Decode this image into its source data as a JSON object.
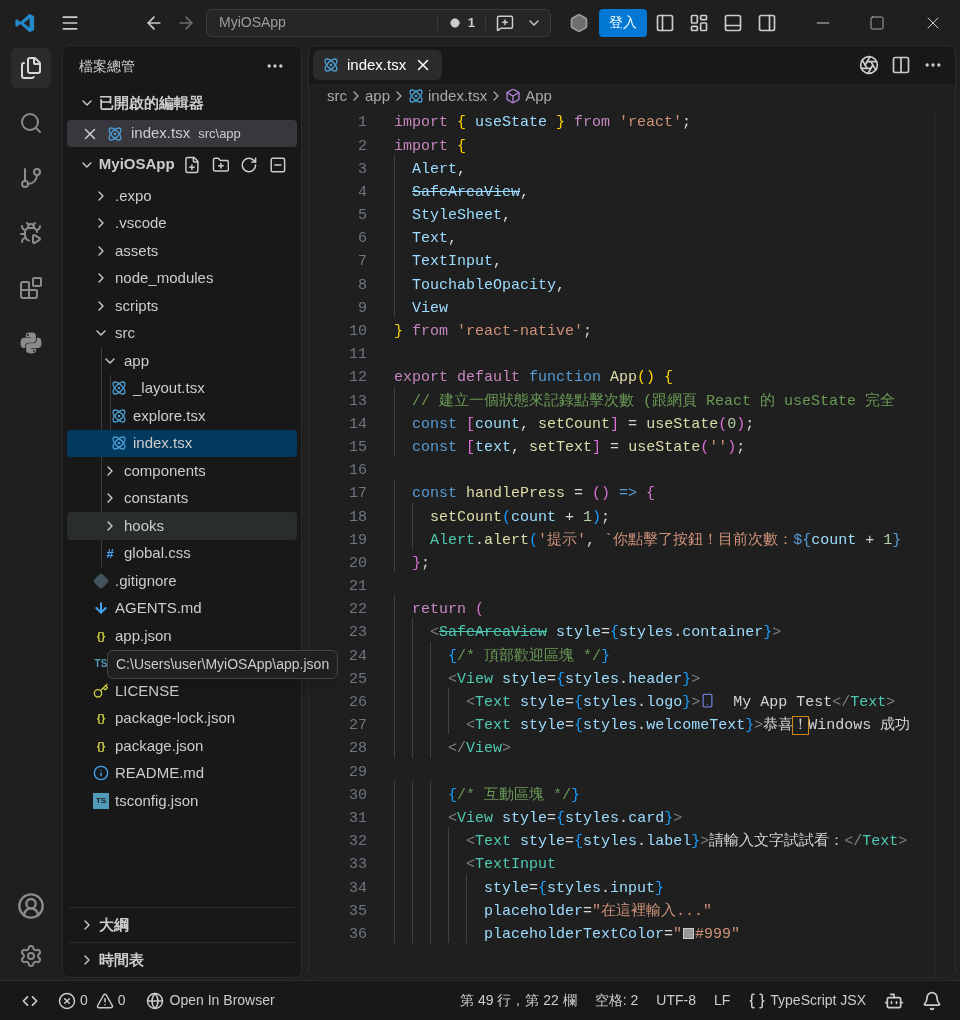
{
  "title_bar": {
    "command_center": "MyiOSApp",
    "count": "1",
    "sign_in": "登入"
  },
  "activity_bar": [
    {
      "kind": "files",
      "selected": true
    },
    {
      "kind": "search",
      "selected": false
    },
    {
      "kind": "source-control",
      "selected": false
    },
    {
      "kind": "run-debug",
      "selected": false
    },
    {
      "kind": "extensions",
      "selected": false
    },
    {
      "kind": "python",
      "selected": false
    }
  ],
  "explorer": {
    "title": "檔案總管",
    "open_editors": {
      "label": "已開啟的編輯器",
      "expanded": true,
      "items": [
        {
          "kind": "react",
          "name": "index.tsx",
          "path": "src\\app",
          "selected": true
        }
      ]
    },
    "project": {
      "label": "MyiOSApp",
      "expanded": true,
      "children": [
        {
          "kind": "folder",
          "name": ".expo",
          "expanded": false,
          "selected": false,
          "hovered": false
        },
        {
          "kind": "folder",
          "name": ".vscode",
          "expanded": false,
          "selected": false,
          "hovered": false
        },
        {
          "kind": "folder",
          "name": "assets",
          "expanded": false,
          "selected": false,
          "hovered": false
        },
        {
          "kind": "folder",
          "name": "node_modules",
          "expanded": false,
          "selected": false,
          "hovered": false
        },
        {
          "kind": "folder",
          "name": "scripts",
          "expanded": false,
          "selected": false,
          "hovered": false
        },
        {
          "kind": "folder",
          "name": "src",
          "expanded": true,
          "selected": false,
          "hovered": false,
          "children": [
            {
              "kind": "folder",
              "name": "app",
              "expanded": true,
              "selected": false,
              "hovered": false,
              "children": [
                {
                  "kind": "react",
                  "name": "_layout.tsx",
                  "selected": false,
                  "hovered": false
                },
                {
                  "kind": "react",
                  "name": "explore.tsx",
                  "selected": false,
                  "hovered": false
                },
                {
                  "kind": "react",
                  "name": "index.tsx",
                  "selected": true,
                  "hovered": false
                }
              ]
            },
            {
              "kind": "folder",
              "name": "components",
              "expanded": false,
              "selected": false,
              "hovered": false
            },
            {
              "kind": "folder",
              "name": "constants",
              "expanded": false,
              "selected": false,
              "hovered": false
            },
            {
              "kind": "folder",
              "name": "hooks",
              "expanded": false,
              "selected": false,
              "hovered": true
            },
            {
              "kind": "css",
              "glyph": "#",
              "name": "global.css",
              "selected": false,
              "hovered": false
            }
          ]
        },
        {
          "kind": "git",
          "name": ".gitignore",
          "selected": false,
          "hovered": false
        },
        {
          "kind": "markdown",
          "name": "AGENTS.md",
          "selected": false,
          "hovered": false
        },
        {
          "kind": "json",
          "glyph": "{}",
          "name": "app.json",
          "selected": false,
          "hovered": false,
          "tooltip": "C:\\Users\\user\\MyiOSApp\\app.json"
        },
        {
          "kind": "ts",
          "glyph": "TS",
          "selected": false,
          "hovered": false
        },
        {
          "kind": "license",
          "name": "LICENSE",
          "selected": false,
          "hovered": false
        },
        {
          "kind": "json",
          "glyph": "{}",
          "name": "package-lock.json",
          "selected": false,
          "hovered": false
        },
        {
          "kind": "json",
          "glyph": "{}",
          "name": "package.json",
          "selected": false,
          "hovered": false
        },
        {
          "kind": "info",
          "name": "README.md",
          "selected": false,
          "hovered": false
        },
        {
          "kind": "tsconfig",
          "glyph": "TS",
          "name": "tsconfig.json",
          "selected": false,
          "hovered": false
        }
      ]
    },
    "panels": [
      {
        "label": "大綱",
        "expanded": false
      },
      {
        "label": "時間表",
        "expanded": false
      }
    ]
  },
  "editor": {
    "tabs": [
      {
        "name": "index.tsx",
        "selected": true
      }
    ],
    "breadcrumb": [
      {
        "kind": "folder",
        "label": "src"
      },
      {
        "kind": "folder",
        "label": "app"
      },
      {
        "kind": "react",
        "label": "index.tsx"
      },
      {
        "kind": "symbol",
        "label": "App"
      }
    ],
    "lines": [
      {
        "n": "1",
        "tokens": [
          {
            "text": "import ",
            "kind": "kw"
          },
          {
            "text": "{ ",
            "kind": "b1"
          },
          {
            "text": "useState ",
            "kind": "var"
          },
          {
            "text": "} ",
            "kind": "b1"
          },
          {
            "text": "from ",
            "kind": "kw"
          },
          {
            "text": "'react'",
            "kind": "str"
          },
          {
            "text": ";",
            "kind": "p"
          }
        ]
      },
      {
        "n": "2",
        "tokens": [
          {
            "text": "import ",
            "kind": "kw"
          },
          {
            "text": "{",
            "kind": "b1"
          }
        ]
      },
      {
        "n": "3",
        "tokens": [
          {
            "text": "  Alert",
            "kind": "var"
          },
          {
            "text": ",",
            "kind": "p"
          }
        ]
      },
      {
        "n": "4",
        "tokens": [
          {
            "text": "  SafeAreaView",
            "kind": "var_strike"
          },
          {
            "text": ",",
            "kind": "p"
          }
        ]
      },
      {
        "n": "5",
        "tokens": [
          {
            "text": "  StyleSheet",
            "kind": "var"
          },
          {
            "text": ",",
            "kind": "p"
          }
        ]
      },
      {
        "n": "6",
        "tokens": [
          {
            "text": "  Text",
            "kind": "var"
          },
          {
            "text": ",",
            "kind": "p"
          }
        ]
      },
      {
        "n": "7",
        "tokens": [
          {
            "text": "  TextInput",
            "kind": "var"
          },
          {
            "text": ",",
            "kind": "p"
          }
        ]
      },
      {
        "n": "8",
        "tokens": [
          {
            "text": "  TouchableOpacity",
            "kind": "var"
          },
          {
            "text": ",",
            "kind": "p"
          }
        ]
      },
      {
        "n": "9",
        "tokens": [
          {
            "text": "  View",
            "kind": "var"
          }
        ]
      },
      {
        "n": "10",
        "tokens": [
          {
            "text": "} ",
            "kind": "b1"
          },
          {
            "text": "from ",
            "kind": "kw"
          },
          {
            "text": "'react-native'",
            "kind": "str"
          },
          {
            "text": ";",
            "kind": "p"
          }
        ]
      },
      {
        "n": "11"
      },
      {
        "n": "12",
        "tokens": [
          {
            "text": "export default ",
            "kind": "kw"
          },
          {
            "text": "function ",
            "kind": "st"
          },
          {
            "text": "App",
            "kind": "fn"
          },
          {
            "text": "() ",
            "kind": "b1"
          },
          {
            "text": "{",
            "kind": "b1"
          }
        ]
      },
      {
        "n": "13",
        "tokens": [
          {
            "text": "  // 建立一個狀態來記錄點擊次數 (跟網頁 React 的 useState 完全",
            "kind": "cm"
          }
        ]
      },
      {
        "n": "14",
        "tokens": [
          {
            "text": "  const ",
            "kind": "st"
          },
          {
            "text": "[",
            "kind": "b2"
          },
          {
            "text": "count",
            "kind": "var"
          },
          {
            "text": ", ",
            "kind": "p"
          },
          {
            "text": "setCount",
            "kind": "fn"
          },
          {
            "text": "]",
            "kind": "b2"
          },
          {
            "text": " = ",
            "kind": "p"
          },
          {
            "text": "useState",
            "kind": "fn"
          },
          {
            "text": "(",
            "kind": "b2"
          },
          {
            "text": "0",
            "kind": "num"
          },
          {
            "text": ")",
            "kind": "b2"
          },
          {
            "text": ";",
            "kind": "p"
          }
        ]
      },
      {
        "n": "15",
        "tokens": [
          {
            "text": "  const ",
            "kind": "st"
          },
          {
            "text": "[",
            "kind": "b2"
          },
          {
            "text": "text",
            "kind": "var"
          },
          {
            "text": ", ",
            "kind": "p"
          },
          {
            "text": "setText",
            "kind": "fn"
          },
          {
            "text": "]",
            "kind": "b2"
          },
          {
            "text": " = ",
            "kind": "p"
          },
          {
            "text": "useState",
            "kind": "fn"
          },
          {
            "text": "(",
            "kind": "b2"
          },
          {
            "text": "''",
            "kind": "str"
          },
          {
            "text": ")",
            "kind": "b2"
          },
          {
            "text": ";",
            "kind": "p"
          }
        ]
      },
      {
        "n": "16"
      },
      {
        "n": "17",
        "tokens": [
          {
            "text": "  const ",
            "kind": "st"
          },
          {
            "text": "handlePress",
            "kind": "fn"
          },
          {
            "text": " = ",
            "kind": "p"
          },
          {
            "text": "() ",
            "kind": "b2"
          },
          {
            "text": "=> ",
            "kind": "st"
          },
          {
            "text": "{",
            "kind": "b2"
          }
        ]
      },
      {
        "n": "18",
        "tokens": [
          {
            "text": "    setCount",
            "kind": "fn"
          },
          {
            "text": "(",
            "kind": "b3"
          },
          {
            "text": "count",
            "kind": "var"
          },
          {
            "text": " + ",
            "kind": "p"
          },
          {
            "text": "1",
            "kind": "num"
          },
          {
            "text": ")",
            "kind": "b3"
          },
          {
            "text": ";",
            "kind": "p"
          }
        ]
      },
      {
        "n": "19",
        "tokens": [
          {
            "text": "    Alert",
            "kind": "tag"
          },
          {
            "text": ".",
            "kind": "p"
          },
          {
            "text": "alert",
            "kind": "fn"
          },
          {
            "text": "(",
            "kind": "b3"
          },
          {
            "text": "'提示'",
            "kind": "str"
          },
          {
            "text": ", ",
            "kind": "p"
          },
          {
            "text": "`你點擊了按鈕！目前次數：",
            "kind": "str"
          },
          {
            "text": "${",
            "kind": "st"
          },
          {
            "text": "count",
            "kind": "var"
          },
          {
            "text": " + ",
            "kind": "p"
          },
          {
            "text": "1",
            "kind": "num"
          },
          {
            "text": "}",
            "kind": "st"
          }
        ]
      },
      {
        "n": "20",
        "tokens": [
          {
            "text": "  }",
            "kind": "b2"
          },
          {
            "text": ";",
            "kind": "p"
          }
        ]
      },
      {
        "n": "21"
      },
      {
        "n": "22",
        "tokens": [
          {
            "text": "  return ",
            "kind": "kw"
          },
          {
            "text": "(",
            "kind": "b2"
          }
        ]
      },
      {
        "n": "23",
        "tokens": [
          {
            "text": "    <",
            "kind": "tp"
          },
          {
            "text": "SafeAreaView",
            "kind": "tag_strike"
          },
          {
            "text": " style",
            "kind": "var"
          },
          {
            "text": "=",
            "kind": "p"
          },
          {
            "text": "{",
            "kind": "b3"
          },
          {
            "text": "styles",
            "kind": "var"
          },
          {
            "text": ".",
            "kind": "p"
          },
          {
            "text": "container",
            "kind": "var"
          },
          {
            "text": "}",
            "kind": "b3"
          },
          {
            "text": ">",
            "kind": "tp"
          }
        ]
      },
      {
        "n": "24",
        "tokens": [
          {
            "text": "      {",
            "kind": "b3"
          },
          {
            "text": "/* 頂部歡迎區塊 */",
            "kind": "cm"
          },
          {
            "text": "}",
            "kind": "b3"
          }
        ]
      },
      {
        "n": "25",
        "tokens": [
          {
            "text": "      <",
            "kind": "tp"
          },
          {
            "text": "View",
            "kind": "tag"
          },
          {
            "text": " style",
            "kind": "var"
          },
          {
            "text": "=",
            "kind": "p"
          },
          {
            "text": "{",
            "kind": "b3"
          },
          {
            "text": "styles",
            "kind": "var"
          },
          {
            "text": ".",
            "kind": "p"
          },
          {
            "text": "header",
            "kind": "var"
          },
          {
            "text": "}",
            "kind": "b3"
          },
          {
            "text": ">",
            "kind": "tp"
          }
        ]
      },
      {
        "n": "26",
        "tokens": [
          {
            "text": "        <",
            "kind": "tp"
          },
          {
            "text": "Text",
            "kind": "tag"
          },
          {
            "text": " style",
            "kind": "var"
          },
          {
            "text": "=",
            "kind": "p"
          },
          {
            "text": "{",
            "kind": "b3"
          },
          {
            "text": "styles",
            "kind": "var"
          },
          {
            "text": ".",
            "kind": "p"
          },
          {
            "text": "logo",
            "kind": "var"
          },
          {
            "text": "}",
            "kind": "b3"
          },
          {
            "text": ">",
            "kind": "tp"
          },
          {
            "kind": "phone"
          },
          {
            "text": "  My App Test",
            "kind": "p"
          },
          {
            "text": "</",
            "kind": "tp"
          },
          {
            "text": "Text",
            "kind": "tag"
          },
          {
            "text": ">",
            "kind": "tp"
          }
        ]
      },
      {
        "n": "27",
        "tokens": [
          {
            "text": "        <",
            "kind": "tp"
          },
          {
            "text": "Text",
            "kind": "tag"
          },
          {
            "text": " style",
            "kind": "var"
          },
          {
            "text": "=",
            "kind": "p"
          },
          {
            "text": "{",
            "kind": "b3"
          },
          {
            "text": "styles",
            "kind": "var"
          },
          {
            "text": ".",
            "kind": "p"
          },
          {
            "text": "welcomeText",
            "kind": "var"
          },
          {
            "text": "}",
            "kind": "b3"
          },
          {
            "text": ">",
            "kind": "tp"
          },
          {
            "text": "恭喜",
            "kind": "p"
          },
          {
            "text": "！",
            "kind": "warn"
          },
          {
            "text": "Windows 成功",
            "kind": "p"
          }
        ]
      },
      {
        "n": "28",
        "tokens": [
          {
            "text": "      </",
            "kind": "tp"
          },
          {
            "text": "View",
            "kind": "tag"
          },
          {
            "text": ">",
            "kind": "tp"
          }
        ]
      },
      {
        "n": "29"
      },
      {
        "n": "30",
        "tokens": [
          {
            "text": "      {",
            "kind": "b3"
          },
          {
            "text": "/* 互動區塊 */",
            "kind": "cm"
          },
          {
            "text": "}",
            "kind": "b3"
          }
        ]
      },
      {
        "n": "31",
        "tokens": [
          {
            "text": "      <",
            "kind": "tp"
          },
          {
            "text": "View",
            "kind": "tag"
          },
          {
            "text": " style",
            "kind": "var"
          },
          {
            "text": "=",
            "kind": "p"
          },
          {
            "text": "{",
            "kind": "b3"
          },
          {
            "text": "styles",
            "kind": "var"
          },
          {
            "text": ".",
            "kind": "p"
          },
          {
            "text": "card",
            "kind": "var"
          },
          {
            "text": "}",
            "kind": "b3"
          },
          {
            "text": ">",
            "kind": "tp"
          }
        ]
      },
      {
        "n": "32",
        "tokens": [
          {
            "text": "        <",
            "kind": "tp"
          },
          {
            "text": "Text",
            "kind": "tag"
          },
          {
            "text": " style",
            "kind": "var"
          },
          {
            "text": "=",
            "kind": "p"
          },
          {
            "text": "{",
            "kind": "b3"
          },
          {
            "text": "styles",
            "kind": "var"
          },
          {
            "text": ".",
            "kind": "p"
          },
          {
            "text": "label",
            "kind": "var"
          },
          {
            "text": "}",
            "kind": "b3"
          },
          {
            "text": ">",
            "kind": "tp"
          },
          {
            "text": "請輸入文字試試看：",
            "kind": "p"
          },
          {
            "text": "</",
            "kind": "tp"
          },
          {
            "text": "Text",
            "kind": "tag"
          },
          {
            "text": ">",
            "kind": "tp"
          }
        ]
      },
      {
        "n": "33",
        "tokens": [
          {
            "text": "        <",
            "kind": "tp"
          },
          {
            "text": "TextInput",
            "kind": "tag"
          }
        ]
      },
      {
        "n": "34",
        "tokens": [
          {
            "text": "          style",
            "kind": "var"
          },
          {
            "text": "=",
            "kind": "p"
          },
          {
            "text": "{",
            "kind": "b3"
          },
          {
            "text": "styles",
            "kind": "var"
          },
          {
            "text": ".",
            "kind": "p"
          },
          {
            "text": "input",
            "kind": "var"
          },
          {
            "text": "}",
            "kind": "b3"
          }
        ]
      },
      {
        "n": "35",
        "tokens": [
          {
            "text": "          placeholder",
            "kind": "var"
          },
          {
            "text": "=",
            "kind": "p"
          },
          {
            "text": "\"在這裡輸入...\"",
            "kind": "str"
          }
        ]
      },
      {
        "n": "36",
        "tokens": [
          {
            "text": "          placeholderTextColor",
            "kind": "var"
          },
          {
            "text": "=",
            "kind": "p"
          },
          {
            "text": "\"",
            "kind": "str"
          },
          {
            "kind": "swatch",
            "color": "#999999"
          },
          {
            "text": "#999\"",
            "kind": "str"
          }
        ]
      }
    ]
  },
  "status_bar": {
    "errors": "0",
    "warnings": "0",
    "open_in_browser": "Open In Browser",
    "position": "第 49 行，第 22 欄",
    "indentation": "空格: 2",
    "encoding": "UTF-8",
    "eol": "LF",
    "language": "TypeScript JSX"
  }
}
